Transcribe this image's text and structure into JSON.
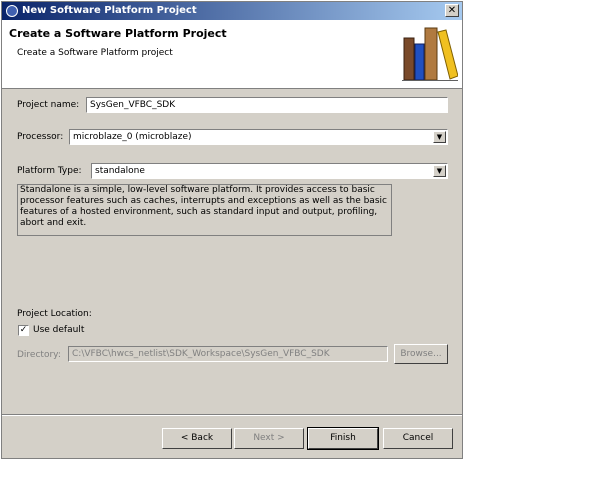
{
  "window": {
    "title": "New Software Platform Project",
    "close_label": "✕"
  },
  "header": {
    "title": "Create a Software Platform Project",
    "subtitle": "Create a Software Platform project"
  },
  "form": {
    "project_name_label": "Project name:",
    "project_name_value": "SysGen_VFBC_SDK",
    "processor_label": "Processor:",
    "processor_value": "microblaze_0 (microblaze)",
    "platform_type_label": "Platform Type:",
    "platform_type_value": "standalone",
    "description": "Standalone is a simple, low-level software platform. It provides access to basic processor features such as caches, interrupts and exceptions as well as the basic features of a hosted environment, such as standard input and output, profiling, abort and exit.",
    "project_location_label": "Project Location:",
    "use_default_label": "Use default",
    "use_default_checked": true,
    "directory_label": "Directory:",
    "directory_value": "C:\\VFBC\\hwcs_netlist\\SDK_Workspace\\SysGen_VFBC_SDK",
    "browse_label": "Browse..."
  },
  "buttons": {
    "back": "< Back",
    "next": "Next >",
    "finish": "Finish",
    "cancel": "Cancel"
  },
  "icons": {
    "dropdown": "chevron-down-icon",
    "books": "books-icon",
    "app": "app-icon"
  },
  "colors": {
    "titlebar_start": "#0a246a",
    "titlebar_end": "#a6caf0",
    "dialog_bg": "#d4d0c8"
  }
}
